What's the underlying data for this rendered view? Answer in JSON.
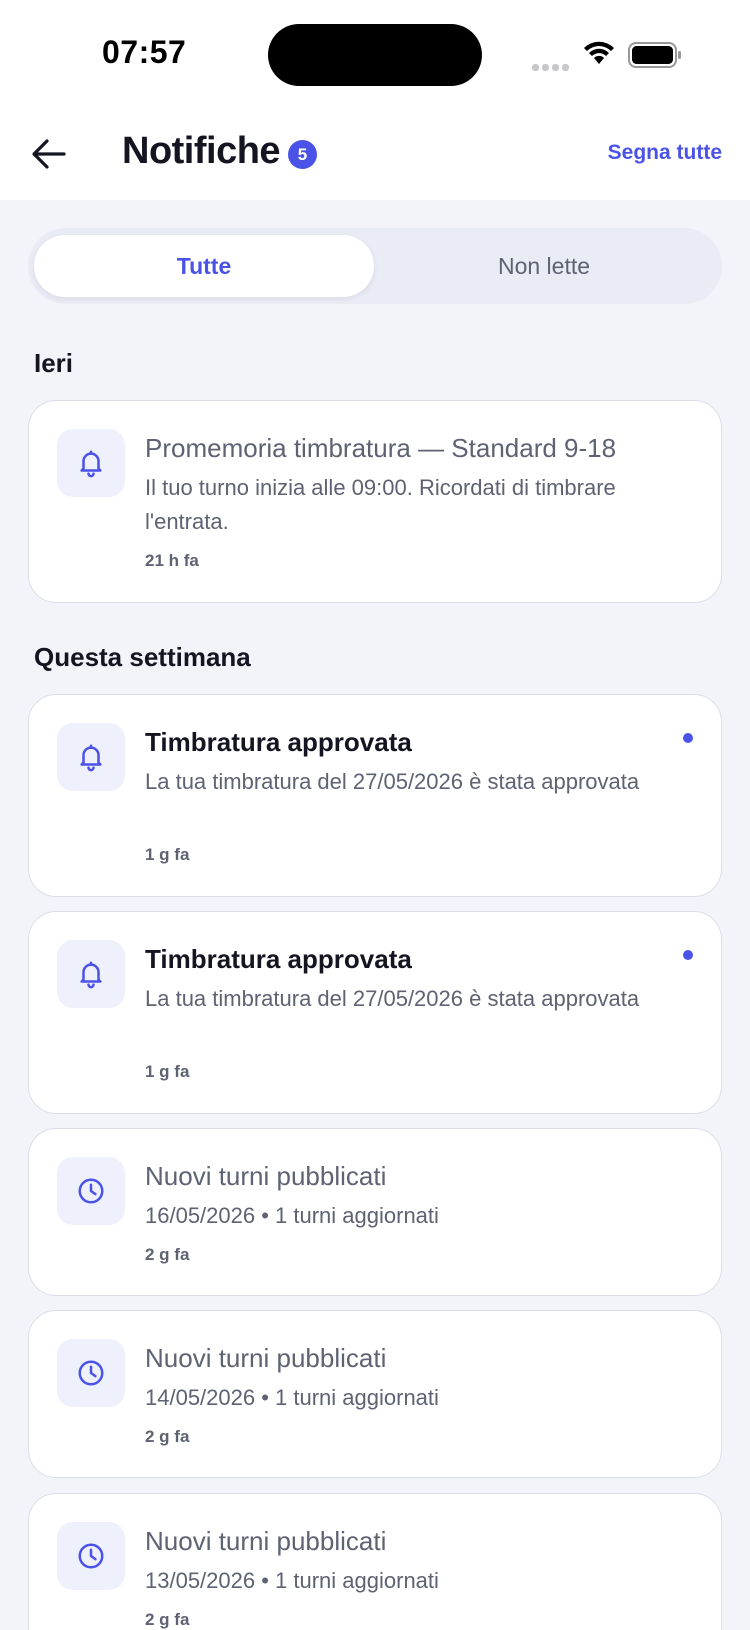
{
  "status_bar": {
    "time": "07:57"
  },
  "header": {
    "title": "Notifiche",
    "unread_count": "5",
    "mark_all_label": "Segna tutte"
  },
  "tabs": [
    {
      "label": "Tutte",
      "active": true
    },
    {
      "label": "Non lette",
      "active": false
    }
  ],
  "sections": [
    {
      "title": "Ieri"
    },
    {
      "title": "Questa settimana"
    }
  ],
  "notifications": [
    {
      "icon": "bell-icon",
      "title": "Promemoria timbratura — Standard 9-18",
      "body": "Il tuo turno inizia alle 09:00. Ricordati di timbrare l'entrata.",
      "time": "21 h fa",
      "unread": false
    },
    {
      "icon": "bell-icon",
      "title": "Timbratura approvata",
      "body": "La tua timbratura del 27/05/2026 è stata approvata",
      "time": "1 g fa",
      "unread": true
    },
    {
      "icon": "bell-icon",
      "title": "Timbratura approvata",
      "body": "La tua timbratura del 27/05/2026 è stata approvata",
      "time": "1 g fa",
      "unread": true
    },
    {
      "icon": "clock-icon",
      "title": "Nuovi turni pubblicati",
      "body": "16/05/2026 • 1 turni aggiornati",
      "time": "2 g fa",
      "unread": false
    },
    {
      "icon": "clock-icon",
      "title": "Nuovi turni pubblicati",
      "body": "14/05/2026 • 1 turni aggiornati",
      "time": "2 g fa",
      "unread": false
    },
    {
      "icon": "clock-icon",
      "title": "Nuovi turni pubblicati",
      "body": "13/05/2026 • 1 turni aggiornati",
      "time": "2 g fa",
      "unread": false
    }
  ],
  "colors": {
    "accent": "#4b52e8",
    "background": "#f2f4fa",
    "icon_bg": "#eef0fc"
  }
}
